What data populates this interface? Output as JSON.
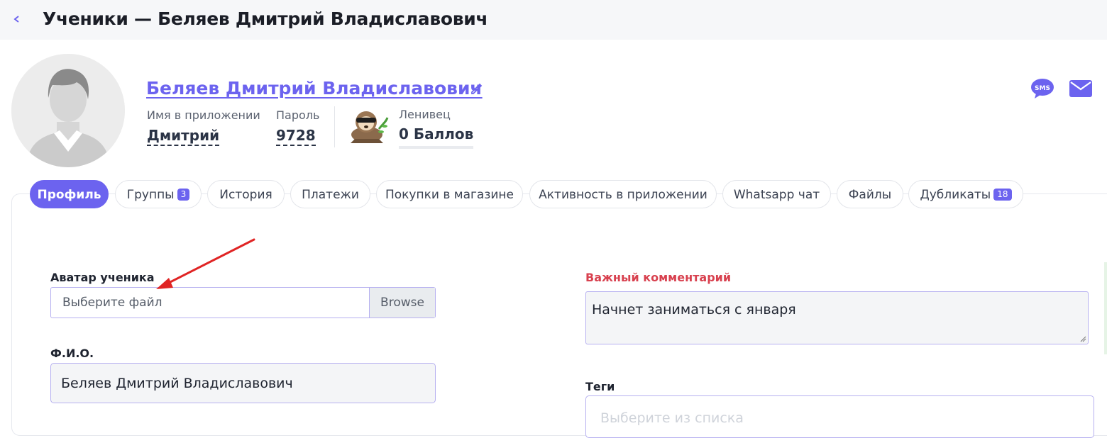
{
  "header": {
    "back_icon": "chevron-left-icon",
    "title": "Ученики — Беляев Дмитрий Владиславович"
  },
  "profile": {
    "avatar_icon": "user-silhouette-icon",
    "name": "Беляев Дмитрий Владиславович",
    "edit_icon": "pencil-icon",
    "app_name_label": "Имя в приложении",
    "app_name_value": "Дмитрий",
    "password_label": "Пароль",
    "password_value": "9728",
    "level_label": "Ленивец",
    "level_icon": "sloth-icon",
    "points": "0 Баллов"
  },
  "actions": {
    "sms_icon": "sms-bubble-icon",
    "sms_label": "SMS",
    "mail_icon": "envelope-icon"
  },
  "tabs": [
    {
      "label": "Профиль",
      "active": true
    },
    {
      "label": "Группы",
      "badge": "3"
    },
    {
      "label": "История"
    },
    {
      "label": "Платежи"
    },
    {
      "label": "Покупки в магазине"
    },
    {
      "label": "Активность в приложении"
    },
    {
      "label": "Whatsapp чат"
    },
    {
      "label": "Файлы"
    },
    {
      "label": "Дубликаты",
      "badge": "18"
    }
  ],
  "form": {
    "avatar_label": "Аватар ученика",
    "avatar_placeholder": "Выберите файл",
    "avatar_browse": "Browse",
    "fio_label": "Ф.И.О.",
    "fio_value": "Беляев Дмитрий Владиславович",
    "comment_label": "Важный комментарий",
    "comment_value": "Начнет заниматься с января",
    "tags_label": "Теги",
    "tags_placeholder": "Выберите из списка"
  },
  "colors": {
    "accent": "#6c63ef",
    "important": "#d8414f",
    "annotation_arrow": "#e02424"
  }
}
